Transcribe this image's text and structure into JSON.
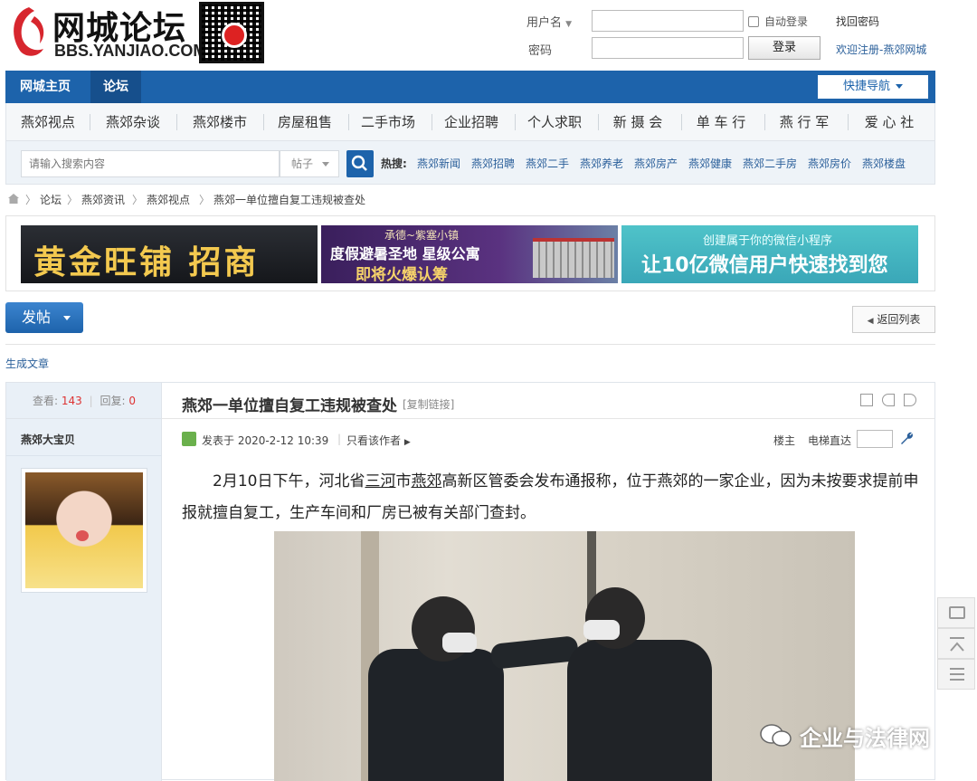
{
  "header": {
    "logo_cn": "网城论坛",
    "logo_en": "BBS.YANJIAO.COM",
    "login": {
      "username_label": "用户名",
      "password_label": "密码",
      "auto_login_label": "自动登录",
      "find_password": "找回密码",
      "login_button": "登录",
      "register_link": "欢迎注册-燕郊网城"
    }
  },
  "mainnav": {
    "tabs": [
      "网城主页",
      "论坛"
    ],
    "quick_nav": "快捷导航"
  },
  "categories": [
    "燕郊视点",
    "燕郊杂谈",
    "燕郊楼市",
    "房屋租售",
    "二手市场",
    "企业招聘",
    "个人求职",
    "新 摄 会",
    "单 车 行",
    "燕 行 军",
    "爱 心 社"
  ],
  "search": {
    "placeholder": "请输入搜索内容",
    "type": "帖子",
    "hot_label": "热搜:",
    "hot_links": [
      "燕郊新闻",
      "燕郊招聘",
      "燕郊二手",
      "燕郊养老",
      "燕郊房产",
      "燕郊健康",
      "燕郊二手房",
      "燕郊房价",
      "燕郊楼盘"
    ]
  },
  "breadcrumb": [
    "论坛",
    "燕郊资讯",
    "燕郊视点",
    "燕郊一单位擅自复工违规被查处"
  ],
  "banners": {
    "b1": "黄金旺铺 招商",
    "b2_top": "承德~紫塞小镇",
    "b2_mid": "度假避暑圣地  星级公寓",
    "b2_bottom": "即将火爆认筹",
    "b3_top": "创建属于你的微信小程序",
    "b3_main": "让10亿微信用户快速找到您"
  },
  "actions": {
    "post_button": "发帖",
    "return_button": "返回列表",
    "generate_article": "生成文章"
  },
  "post": {
    "views_label": "查看:",
    "views": "143",
    "replies_label": "回复:",
    "replies": "0",
    "author": "燕郊大宝贝",
    "title": "燕郊一单位擅自复工违规被查处",
    "copy_link": "[复制链接]",
    "posted_at": "发表于 2020-2-12 10:39",
    "only_author": "只看该作者",
    "floor": "楼主",
    "elevator": "电梯直达",
    "body_1": "2月10日下午，河北省",
    "body_link1": "三河",
    "body_2": "市",
    "body_link2": "燕郊",
    "body_3": "高新区管委会发布通报称，位于燕郊的一家企业，因为未按要求提前申报就擅自复工，生产车间和厂房已被有关部门查封。"
  },
  "watermark": "企业与法律网",
  "colors": {
    "nav_blue": "#1d63ab",
    "link_blue": "#2a5f9a",
    "stat_red": "#d33"
  }
}
